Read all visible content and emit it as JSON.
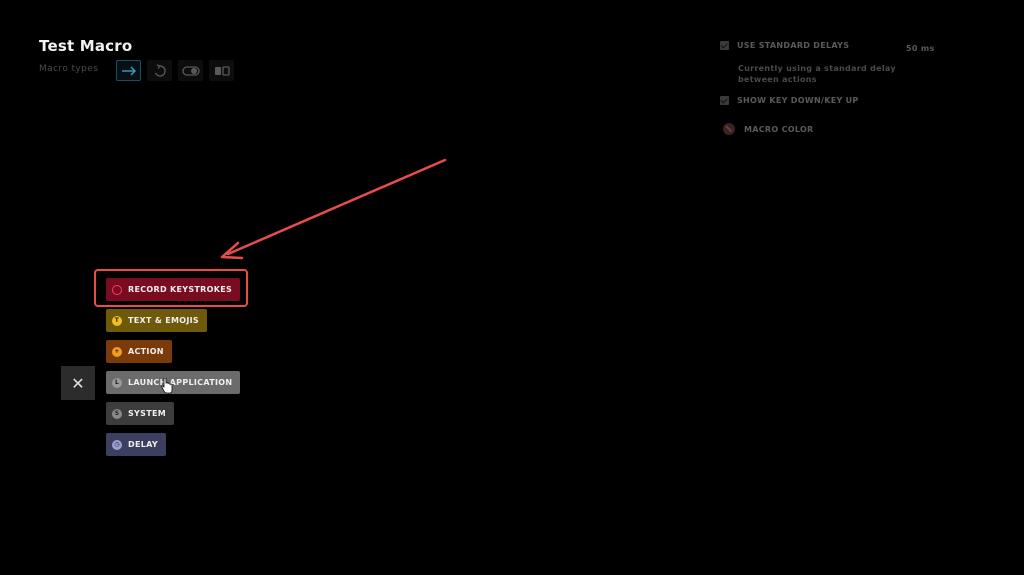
{
  "header": {
    "title": "Test Macro",
    "macro_types_label": "Macro types",
    "macro_types": [
      {
        "icon": "arrow-right-icon",
        "active": true
      },
      {
        "icon": "repeat-icon",
        "active": false
      },
      {
        "icon": "toggle-icon",
        "active": false
      },
      {
        "icon": "sequence-icon",
        "active": false
      }
    ]
  },
  "settings": {
    "standard_delays_label": "USE STANDARD DELAYS",
    "standard_delays_value": "50 ms",
    "standard_delays_note": "Currently using a standard delay between actions",
    "key_down_up_label": "SHOW KEY DOWN/KEY UP",
    "macro_color_label": "MACRO COLOR"
  },
  "menu": {
    "close_icon": "close-icon",
    "items": [
      {
        "label": "RECORD KEYSTROKES",
        "color": "#7a0c22",
        "dot_color": "#ff3b5c",
        "icon": "record-icon"
      },
      {
        "label": "TEXT & EMOJIS",
        "color": "#6e5a0a",
        "dot_color": "#f2c21b",
        "icon": "text-emoji-icon",
        "glyph": "T"
      },
      {
        "label": "ACTION",
        "color": "#7a3a0a",
        "dot_color": "#f39c22",
        "icon": "action-icon",
        "glyph": "+"
      },
      {
        "label": "LAUNCH APPLICATION",
        "color": "#6b6b6b",
        "dot_color": "#9a9a9a",
        "icon": "launch-app-icon",
        "glyph": "L"
      },
      {
        "label": "SYSTEM",
        "color": "#3c3c3c",
        "dot_color": "#8a8a8a",
        "icon": "system-icon",
        "glyph": "S"
      },
      {
        "label": "DELAY",
        "color": "#3d3f60",
        "dot_color": "#9aa0d8",
        "icon": "delay-icon",
        "glyph": "◷"
      }
    ]
  },
  "annotation": {
    "color": "#e84c4c"
  }
}
